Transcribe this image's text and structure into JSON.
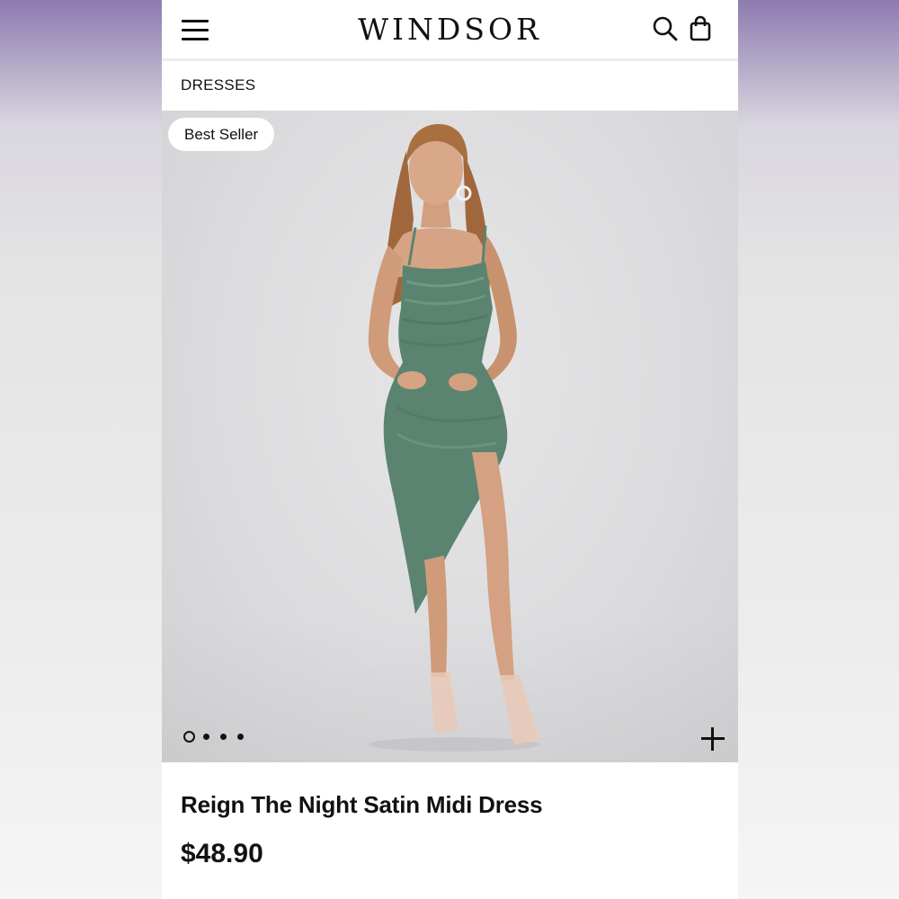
{
  "header": {
    "brand": "WINDSOR",
    "menu_icon": "hamburger-menu-icon",
    "search_icon": "search-icon",
    "bag_icon": "shopping-bag-icon"
  },
  "breadcrumb": {
    "label": "DRESSES"
  },
  "product": {
    "badge": "Best Seller",
    "name": "Reign The Night Satin Midi Dress",
    "price": "$48.90",
    "dress_color": "#5b8470",
    "carousel": {
      "total_images": 4,
      "active_index": 0
    },
    "expand_icon": "plus-icon"
  }
}
